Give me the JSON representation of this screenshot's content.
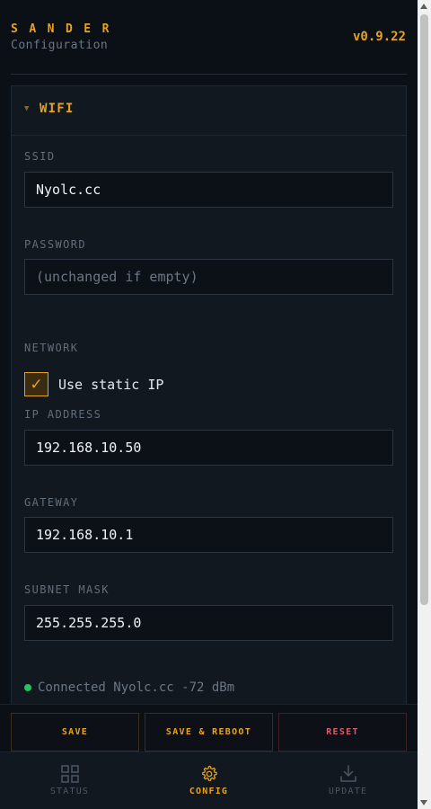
{
  "header": {
    "brand": "SANDER",
    "subtitle": "Configuration",
    "version": "v0.9.22"
  },
  "wifi_panel": {
    "title": "WIFI",
    "expanded": true,
    "ssid_label": "SSID",
    "ssid_value": "Nyolc.cc",
    "password_label": "PASSWORD",
    "password_value": "",
    "password_placeholder": "(unchanged if empty)",
    "network_label": "NETWORK",
    "static_ip_checked": true,
    "static_ip_label": "Use static IP",
    "ip_label": "IP ADDRESS",
    "ip_value": "192.168.10.50",
    "gateway_label": "GATEWAY",
    "gateway_value": "192.168.10.1",
    "subnet_label": "SUBNET MASK",
    "subnet_value": "255.255.255.0",
    "connection_status": "Connected Nyolc.cc -72 dBm",
    "status_color": "#22c55e"
  },
  "actions": {
    "save": "SAVE",
    "save_reboot": "SAVE & REBOOT",
    "reset": "RESET"
  },
  "nav": {
    "active": "config",
    "items": [
      {
        "id": "status",
        "label": "STATUS",
        "icon": "grid-icon"
      },
      {
        "id": "config",
        "label": "CONFIG",
        "icon": "gear-icon"
      },
      {
        "id": "update",
        "label": "UPDATE",
        "icon": "download-icon"
      }
    ]
  },
  "colors": {
    "accent": "#e8a21e",
    "danger": "#e05a64",
    "background": "#0b0f16",
    "panel": "#111820"
  }
}
